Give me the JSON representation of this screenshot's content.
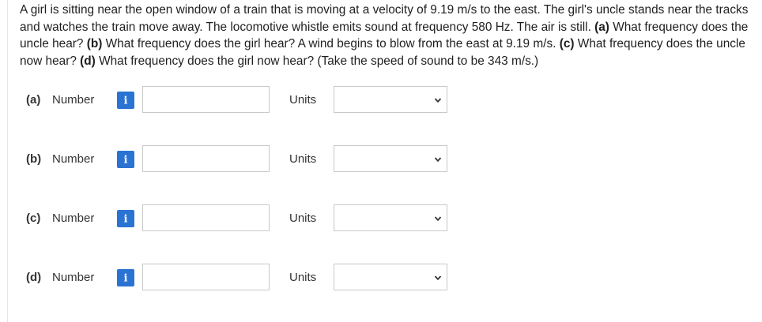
{
  "question": {
    "intro": "A girl is sitting near the open window of a train that is moving at a velocity of 9.19 m/s to the east. The girl's uncle stands near the tracks and watches the train move away. The locomotive whistle emits sound at frequency 580 Hz. The air is still. ",
    "a_tag": "(a)",
    "a_text": " What frequency does the uncle hear? ",
    "b_tag": "(b)",
    "b_text": " What frequency does the girl hear? A wind begins to blow from the east at 9.19 m/s. ",
    "c_tag": "(c)",
    "c_text": " What frequency does the uncle now hear? ",
    "d_tag": "(d)",
    "d_text": " What frequency does the girl now hear? (Take the speed of sound to be 343 m/s.)"
  },
  "parts": [
    {
      "label": "(a)",
      "number_label": "Number",
      "number_value": "",
      "units_label": "Units",
      "units_value": ""
    },
    {
      "label": "(b)",
      "number_label": "Number",
      "number_value": "",
      "units_label": "Units",
      "units_value": ""
    },
    {
      "label": "(c)",
      "number_label": "Number",
      "number_value": "",
      "units_label": "Units",
      "units_value": ""
    },
    {
      "label": "(d)",
      "number_label": "Number",
      "number_value": "",
      "units_label": "Units",
      "units_value": ""
    }
  ],
  "icons": {
    "info": "info-icon",
    "chevron": "chevron-down-icon"
  },
  "colors": {
    "info_button": "#2b73d3",
    "input_border": "#c9c9c9"
  }
}
